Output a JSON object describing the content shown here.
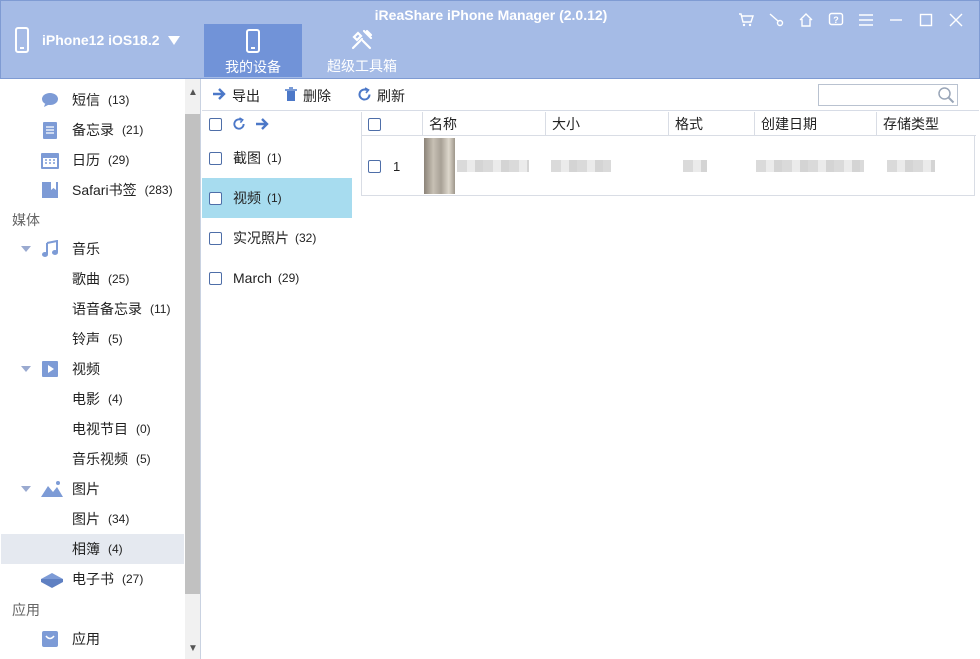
{
  "app": {
    "title": "iReaShare iPhone Manager (2.0.12)"
  },
  "device": {
    "name": "iPhone12 iOS18.2"
  },
  "tabs": [
    {
      "label": "我的设备",
      "icon": "phone-icon",
      "active": true
    },
    {
      "label": "超级工具箱",
      "icon": "tools-icon",
      "active": false
    }
  ],
  "window_controls": [
    "cart-icon",
    "key-icon",
    "home-icon",
    "help-icon",
    "menu-icon",
    "minimize-icon",
    "maximize-icon",
    "close-icon"
  ],
  "sidebar": {
    "items": [
      {
        "label": "短信",
        "count": "(13)",
        "icon": "message-icon"
      },
      {
        "label": "备忘录",
        "count": "(21)",
        "icon": "notes-icon"
      },
      {
        "label": "日历",
        "count": "(29)",
        "icon": "calendar-icon"
      },
      {
        "label": "Safari书签",
        "count": "(283)",
        "icon": "bookmark-icon"
      }
    ],
    "media_section": "媒体",
    "music": {
      "label": "音乐",
      "icon": "music-icon",
      "children": [
        {
          "label": "歌曲",
          "count": "(25)"
        },
        {
          "label": "语音备忘录",
          "count": "(11)"
        },
        {
          "label": "铃声",
          "count": "(5)"
        }
      ]
    },
    "video": {
      "label": "视频",
      "icon": "video-icon",
      "children": [
        {
          "label": "电影",
          "count": "(4)"
        },
        {
          "label": "电视节目",
          "count": "(0)"
        },
        {
          "label": "音乐视频",
          "count": "(5)"
        }
      ]
    },
    "photos": {
      "label": "图片",
      "icon": "image-icon",
      "children": [
        {
          "label": "图片",
          "count": "(34)"
        },
        {
          "label": "相簿",
          "count": "(4)",
          "selected": true
        }
      ]
    },
    "ebook": {
      "label": "电子书",
      "count": "(27)",
      "icon": "book-icon"
    },
    "apps_section": "应用",
    "apps": {
      "label": "应用",
      "icon": "app-icon"
    }
  },
  "toolbar": {
    "export_label": "导出",
    "delete_label": "删除",
    "refresh_label": "刷新",
    "search_placeholder": ""
  },
  "albums": [
    {
      "label": "截图",
      "count": "(1)",
      "selected": false
    },
    {
      "label": "视频",
      "count": "(1)",
      "selected": true
    },
    {
      "label": "实况照片",
      "count": "(32)",
      "selected": false
    },
    {
      "label": "March",
      "count": "(29)",
      "selected": false
    }
  ],
  "table": {
    "columns": [
      "名称",
      "大小",
      "格式",
      "创建日期",
      "存储类型"
    ],
    "rows": [
      {
        "index": "1"
      }
    ]
  },
  "colors": {
    "header_bg": "#a5bbe6",
    "active_tab": "#7193d8",
    "selected_album": "#a7dcef",
    "accent": "#4c78c8"
  }
}
